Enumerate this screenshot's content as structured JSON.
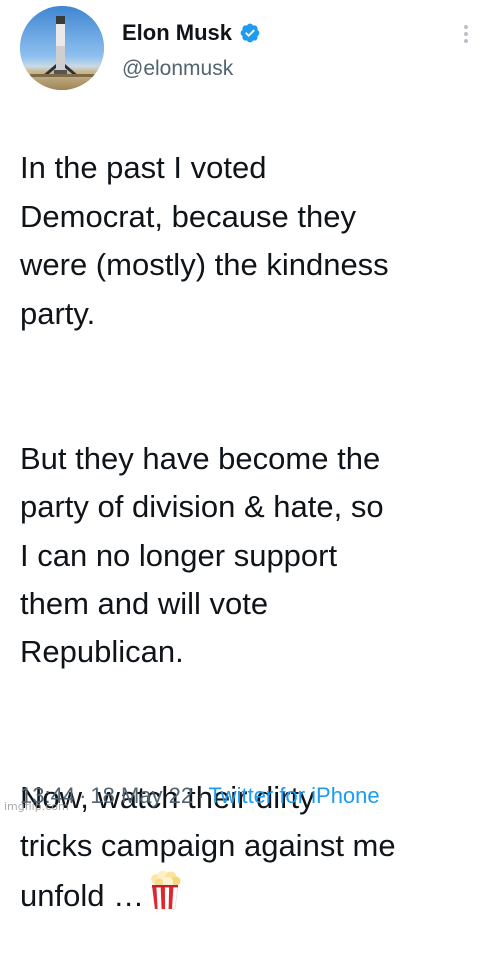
{
  "author": {
    "display_name": "Elon Musk",
    "handle": "@elonmusk",
    "verified": true,
    "verified_color": "#1d9bf0"
  },
  "tweet": {
    "paragraphs": [
      "In the past I voted\nDemocrat, because they\nwere (mostly) the kindness\nparty.",
      "But they have become the\nparty of division & hate, so\nI can no longer support\nthem and will vote\nRepublican.",
      "Now, watch their dirty\ntricks campaign against me\nunfold …"
    ],
    "emoji": "popcorn-icon"
  },
  "meta": {
    "time": "13:44",
    "separator": "·",
    "date": "18 May 22",
    "source": "Twitter for iPhone"
  },
  "watermark": "imgflip.com",
  "colors": {
    "text": "#0f1419",
    "secondary": "#536471",
    "link": "#1d9bf0"
  }
}
